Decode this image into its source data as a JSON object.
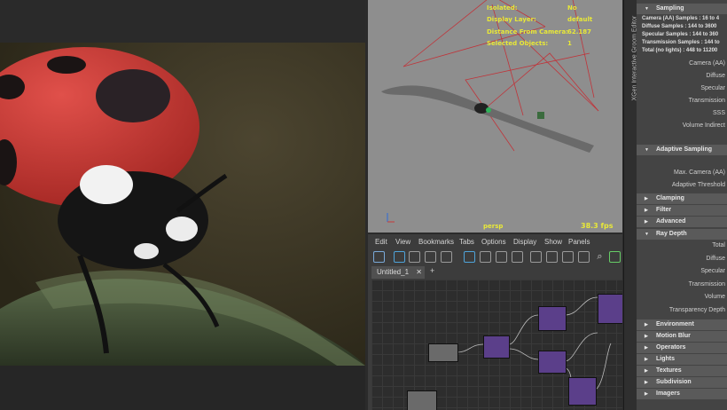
{
  "viewport": {
    "hud": [
      {
        "label": "Isolated:",
        "value": "No"
      },
      {
        "label": "Display Layer:",
        "value": "default"
      },
      {
        "label": "Distance From Camera:",
        "value": "62.187"
      },
      {
        "label": "Selected Objects:",
        "value": "1"
      }
    ],
    "camera_name": "persp",
    "fps": "38.3 fps"
  },
  "node_editor": {
    "menu": [
      "Edit",
      "View",
      "Bookmarks",
      "Tabs",
      "Options",
      "Display",
      "Show",
      "Panels"
    ],
    "tab_label": "Untitled_1",
    "tab_close": "✕",
    "tab_add": "+"
  },
  "side_tab": {
    "label": "XGen Interactive Groom Editor"
  },
  "arnold": {
    "sampling": {
      "title": "Sampling",
      "stats": [
        "Camera (AA) Samples : 16 to 4",
        "Diffuse Samples : 144 to 3600",
        "Specular Samples : 144 to 360",
        "Transmission Samples : 144 to",
        "Total (no lights) : 448 to 11200"
      ],
      "fields": [
        "Camera (AA)",
        "Diffuse",
        "Specular",
        "Transmission",
        "SSS",
        "Volume Indirect"
      ]
    },
    "adaptive": {
      "title": "Adaptive Sampling",
      "fields": [
        "Max. Camera (AA)",
        "Adaptive Threshold"
      ]
    },
    "collapsed_a": [
      "Clamping",
      "Filter",
      "Advanced"
    ],
    "ray_depth": {
      "title": "Ray Depth",
      "fields": [
        "Total",
        "Diffuse",
        "Specular",
        "Transmission",
        "Volume",
        "Transparency Depth"
      ]
    },
    "collapsed_b": [
      "Environment",
      "Motion Blur",
      "Operators",
      "Lights",
      "Textures",
      "Subdivision",
      "Imagers"
    ]
  }
}
